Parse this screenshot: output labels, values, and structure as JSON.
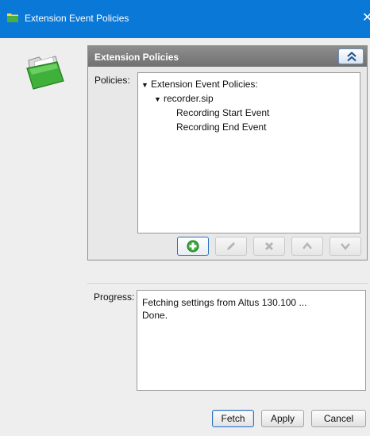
{
  "window": {
    "title": "Extension Event Policies",
    "close_glyph": "✕",
    "title_icon": "folder-icon",
    "accent_color": "#0a78d7"
  },
  "panel": {
    "header_title": "Extension Policies",
    "collapse_icon": "double-chevron-up-icon"
  },
  "policies": {
    "label": "Policies:",
    "tree": [
      {
        "label": "Extension Event Policies:",
        "expanded": true,
        "level": 0
      },
      {
        "label": "recorder.sip",
        "expanded": true,
        "level": 1
      },
      {
        "label": "Recording Start Event",
        "level": 2
      },
      {
        "label": "Recording End Event",
        "level": 2
      }
    ],
    "toolbar": [
      "add-icon",
      "edit-icon",
      "delete-icon",
      "move-up-icon",
      "move-down-icon"
    ]
  },
  "progress": {
    "label": "Progress:",
    "lines": [
      "Fetching settings from Altus 130.100 ...",
      "Done."
    ]
  },
  "buttons": {
    "fetch": "Fetch",
    "apply": "Apply",
    "cancel": "Cancel"
  }
}
